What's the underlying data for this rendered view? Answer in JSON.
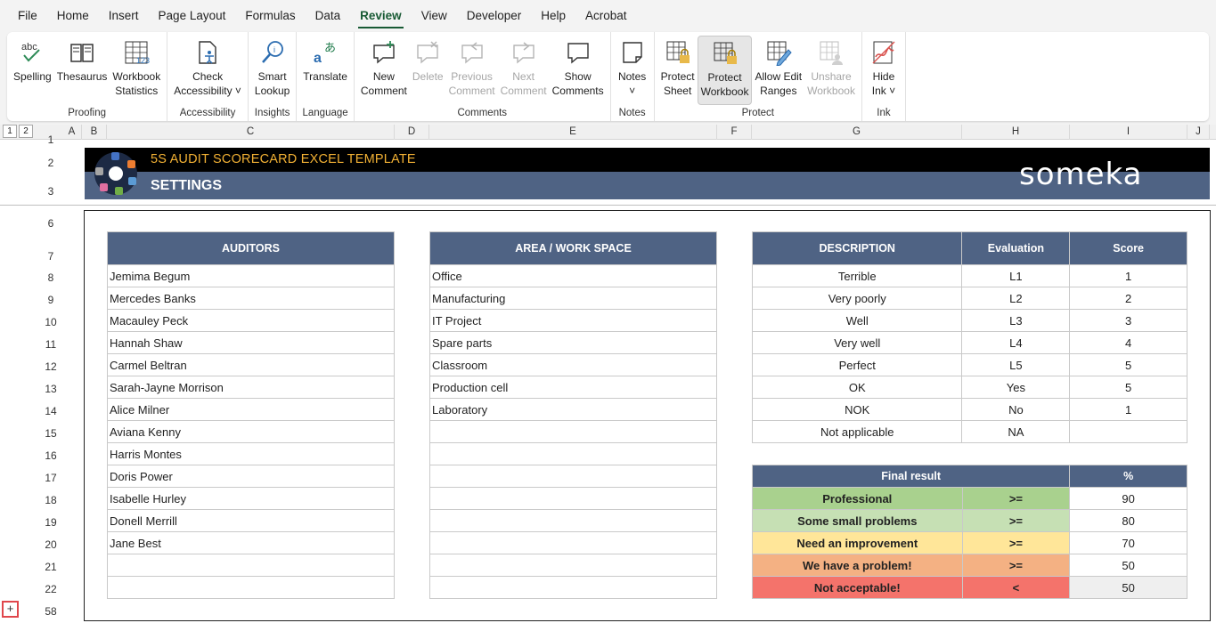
{
  "menu": [
    "File",
    "Home",
    "Insert",
    "Page Layout",
    "Formulas",
    "Data",
    "Review",
    "View",
    "Developer",
    "Help",
    "Acrobat"
  ],
  "active_menu": "Review",
  "ribbon": {
    "groups": [
      {
        "label": "Proofing",
        "buttons": [
          {
            "label": "Spelling",
            "icon": "spelling-icon",
            "disabled": false
          },
          {
            "label": "Thesaurus",
            "icon": "thesaurus-icon",
            "disabled": false
          },
          {
            "label": "Workbook\nStatistics",
            "icon": "statistics-icon",
            "disabled": false
          }
        ]
      },
      {
        "label": "Accessibility",
        "buttons": [
          {
            "label": "Check\nAccessibility ˅",
            "icon": "accessibility-icon",
            "disabled": false
          }
        ]
      },
      {
        "label": "Insights",
        "buttons": [
          {
            "label": "Smart\nLookup",
            "icon": "smart-lookup-icon",
            "disabled": false
          }
        ]
      },
      {
        "label": "Language",
        "buttons": [
          {
            "label": "Translate",
            "icon": "translate-icon",
            "disabled": false
          }
        ]
      },
      {
        "label": "Comments",
        "buttons": [
          {
            "label": "New\nComment",
            "icon": "new-comment-icon",
            "disabled": false
          },
          {
            "label": "Delete",
            "icon": "delete-comment-icon",
            "disabled": true
          },
          {
            "label": "Previous\nComment",
            "icon": "previous-comment-icon",
            "disabled": true
          },
          {
            "label": "Next\nComment",
            "icon": "next-comment-icon",
            "disabled": true
          },
          {
            "label": "Show\nComments",
            "icon": "show-comments-icon",
            "disabled": false
          }
        ]
      },
      {
        "label": "Notes",
        "buttons": [
          {
            "label": "Notes\n˅",
            "icon": "notes-icon",
            "disabled": false
          }
        ]
      },
      {
        "label": "Protect",
        "buttons": [
          {
            "label": "Protect\nSheet",
            "icon": "protect-sheet-icon",
            "disabled": false
          },
          {
            "label": "Protect\nWorkbook",
            "icon": "protect-workbook-icon",
            "disabled": false,
            "pressed": true
          },
          {
            "label": "Allow Edit\nRanges",
            "icon": "allow-edit-ranges-icon",
            "disabled": false
          },
          {
            "label": "Unshare\nWorkbook",
            "icon": "unshare-workbook-icon",
            "disabled": true
          }
        ]
      },
      {
        "label": "Ink",
        "buttons": [
          {
            "label": "Hide\nInk ˅",
            "icon": "hide-ink-icon",
            "disabled": false
          }
        ]
      }
    ]
  },
  "outline_levels": [
    "1",
    "2"
  ],
  "columns": [
    "A",
    "B",
    "C",
    "D",
    "E",
    "F",
    "G",
    "H",
    "I",
    "J"
  ],
  "rows": [
    "1",
    "2",
    "3",
    "6",
    "7",
    "8",
    "9",
    "10",
    "11",
    "12",
    "13",
    "14",
    "15",
    "16",
    "17",
    "18",
    "19",
    "20",
    "21",
    "22",
    "58"
  ],
  "banner": {
    "title": "5S AUDIT SCORECARD EXCEL TEMPLATE",
    "subtitle": "SETTINGS",
    "brand": "someka"
  },
  "auditors": {
    "header": "AUDITORS",
    "items": [
      "Jemima Begum",
      "Mercedes Banks",
      "Macauley Peck",
      "Hannah Shaw",
      "Carmel Beltran",
      "Sarah-Jayne Morrison",
      "Alice Milner",
      "Aviana Kenny",
      "Harris Montes",
      "Doris Power",
      "Isabelle Hurley",
      "Donell Merrill",
      "Jane Best",
      "",
      ""
    ]
  },
  "areas": {
    "header": "AREA / WORK SPACE",
    "items": [
      "Office",
      "Manufacturing",
      "IT Project",
      "Spare parts",
      "Classroom",
      "Production cell",
      "Laboratory",
      "",
      "",
      "",
      "",
      "",
      "",
      "",
      ""
    ]
  },
  "scores": {
    "headers": [
      "DESCRIPTION",
      "Evaluation",
      "Score"
    ],
    "rows": [
      [
        "Terrible",
        "L1",
        "1"
      ],
      [
        "Very poorly",
        "L2",
        "2"
      ],
      [
        "Well",
        "L3",
        "3"
      ],
      [
        "Very well",
        "L4",
        "4"
      ],
      [
        "Perfect",
        "L5",
        "5"
      ],
      [
        "OK",
        "Yes",
        "5"
      ],
      [
        "NOK",
        "No",
        "1"
      ],
      [
        "Not applicable",
        "NA",
        ""
      ]
    ]
  },
  "final_result": {
    "headers": [
      "Final result",
      "%"
    ],
    "rows": [
      {
        "label": "Professional",
        "op": ">=",
        "value": "90",
        "color": "#a9d18e"
      },
      {
        "label": "Some small problems",
        "op": ">=",
        "value": "80",
        "color": "#c6e0b4"
      },
      {
        "label": "Need an improvement",
        "op": ">=",
        "value": "70",
        "color": "#ffe699"
      },
      {
        "label": "We have a problem!",
        "op": ">=",
        "value": "50",
        "color": "#f4b183"
      },
      {
        "label": "Not acceptable!",
        "op": "<",
        "value": "50",
        "color": "#f4736b"
      }
    ]
  },
  "colors": {
    "header_blue": "#4f6384",
    "accent_green": "#185a34",
    "title_orange": "#f2b134"
  }
}
